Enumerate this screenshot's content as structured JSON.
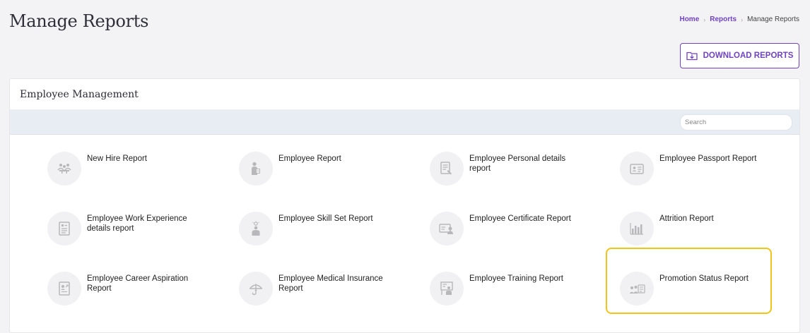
{
  "page": {
    "title": "Manage Reports",
    "breadcrumb": {
      "home": "Home",
      "reports": "Reports",
      "current": "Manage Reports"
    },
    "download_label": "DOWNLOAD REPORTS"
  },
  "card": {
    "title": "Employee Management",
    "search_placeholder": "Search"
  },
  "reports": [
    {
      "label": "New Hire Report",
      "icon": "people-meeting-icon"
    },
    {
      "label": "Employee Report",
      "icon": "employee-badge-icon"
    },
    {
      "label": "Employee Personal details report",
      "icon": "document-form-icon"
    },
    {
      "label": "Employee Passport Report",
      "icon": "id-card-icon"
    },
    {
      "label": "Employee Work Experience details report",
      "icon": "document-lines-icon"
    },
    {
      "label": "Employee Skill Set Report",
      "icon": "skill-person-icon"
    },
    {
      "label": "Employee Certificate Report",
      "icon": "certificate-icon"
    },
    {
      "label": "Attrition Report",
      "icon": "bar-chart-icon"
    },
    {
      "label": "Employee Career Aspiration Report",
      "icon": "career-document-icon"
    },
    {
      "label": "Employee Medical Insurance Report",
      "icon": "umbrella-icon"
    },
    {
      "label": "Employee Training Report",
      "icon": "training-board-icon"
    },
    {
      "label": "Promotion Status Report",
      "icon": "promotion-people-icon"
    }
  ],
  "colors": {
    "accent": "#6f42c1",
    "highlight": "#f0c419",
    "icon_gray": "#b8b8bc"
  }
}
